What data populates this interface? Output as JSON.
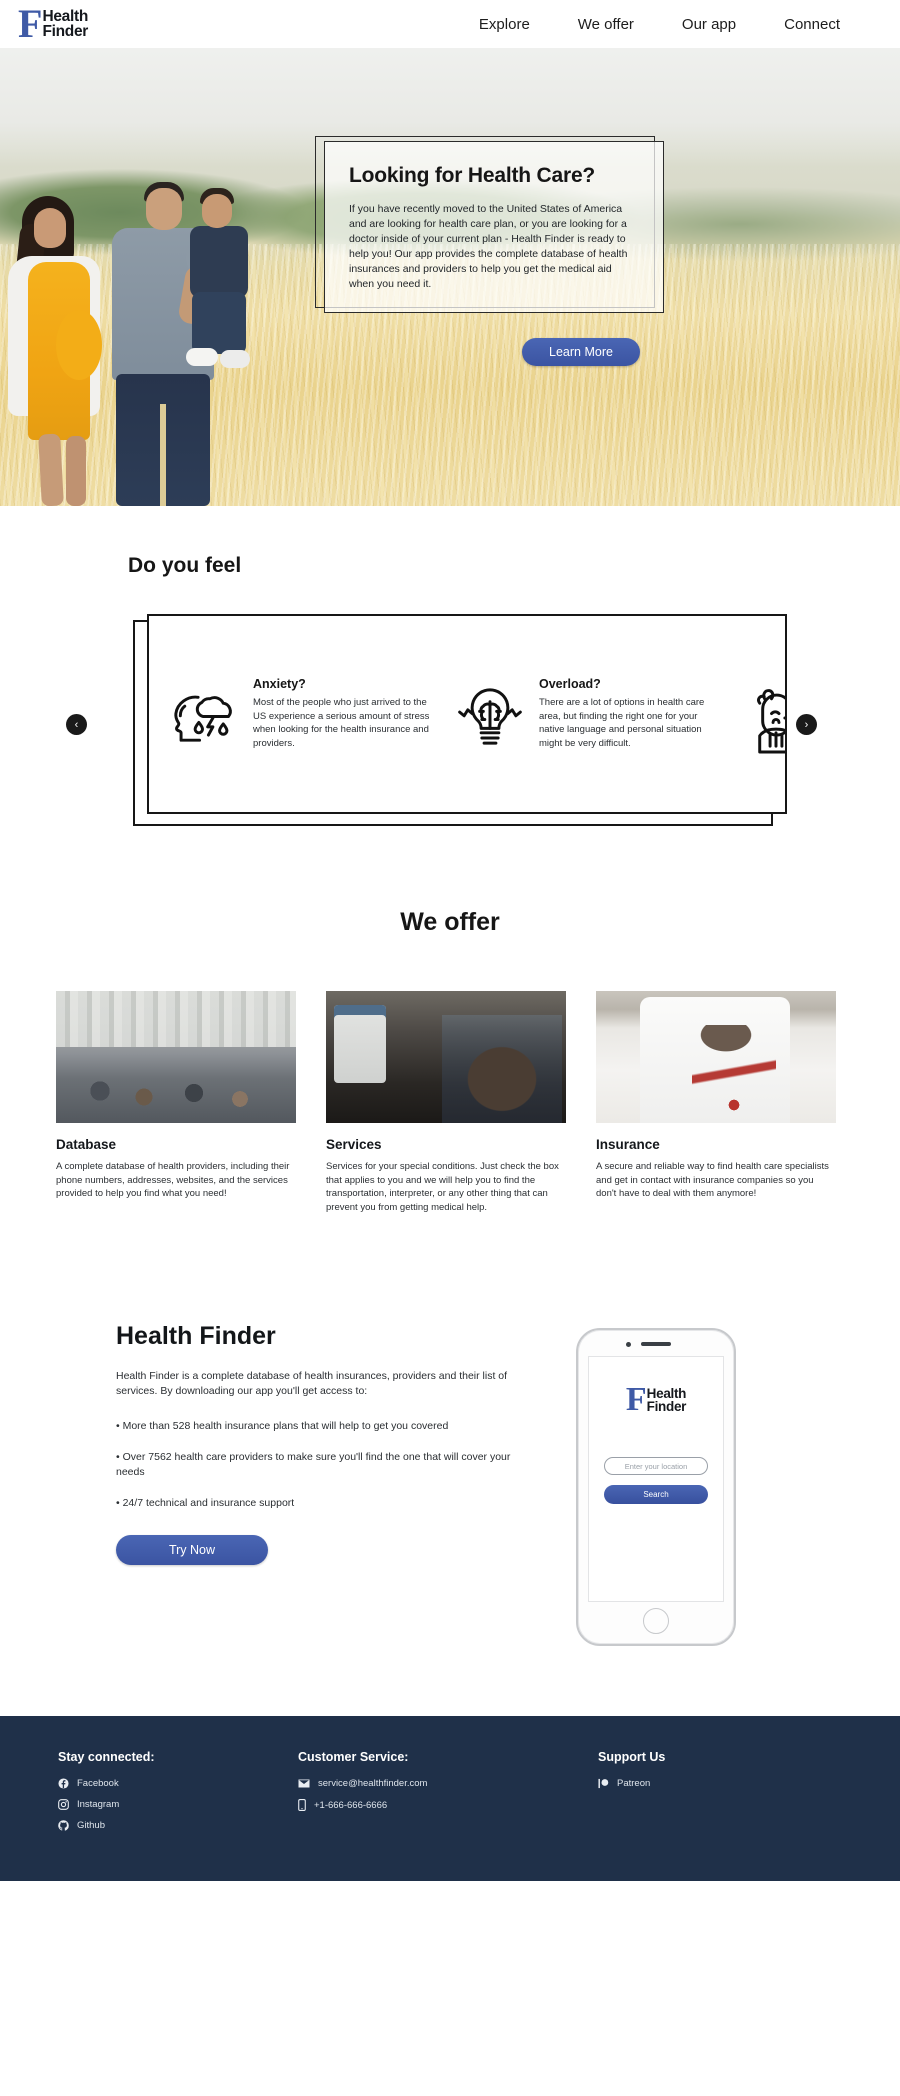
{
  "brand": {
    "mark": "F",
    "line1": "Health",
    "line2": "Finder"
  },
  "nav": {
    "items": [
      {
        "label": "Explore",
        "name": "nav-explore"
      },
      {
        "label": "We offer",
        "name": "nav-we-offer"
      },
      {
        "label": "Our app",
        "name": "nav-our-app"
      },
      {
        "label": "Connect",
        "name": "nav-connect"
      }
    ]
  },
  "hero": {
    "title": "Looking for Health Care?",
    "body": "If you have recently moved to the United States of America and are looking for health care plan, or you are looking for a doctor inside of your current plan - Health Finder is ready to help you! Our app provides the complete database of health insurances and providers to help you get the medical aid when you need it.",
    "cta": "Learn More",
    "cta_color": "#3e57a5"
  },
  "feel": {
    "title": "Do you feel",
    "prev_label": "‹",
    "next_label": "›",
    "cards": [
      {
        "icon": "head-storm-cloud-icon",
        "title": "Anxiety?",
        "text": "Most of the people who just arrived to the US experience a serious amount of stress when looking for the health insurance and providers."
      },
      {
        "icon": "lightbulb-brain-icon",
        "title": "Overload?",
        "text": "There are a lot of options in health care area, but finding the right one for your native language and personal situation might be very difficult."
      },
      {
        "icon": "confused-person-icon",
        "title": "",
        "text": ""
      }
    ]
  },
  "offer": {
    "title": "We offer",
    "cards": [
      {
        "image": "pharmacy-photo",
        "name": "Database",
        "text": "A complete database of health providers, including their phone numbers, addresses, websites, and the services provided to help you find what you need!"
      },
      {
        "image": "nurse-patient-photo",
        "name": "Services",
        "text": "Services for your special conditions. Just check the box that applies to you and we will help you to find the transportation, interpreter, or any other thing that can prevent you from getting medical help."
      },
      {
        "image": "doctor-stethoscope-photo",
        "name": "Insurance",
        "text": "A secure and reliable way to find health care specialists and get in contact with insurance companies so you don't have to deal with them anymore!"
      }
    ]
  },
  "app": {
    "title": "Health Finder",
    "intro": "Health Finder is a complete database of health insurances, providers and their list of services. By downloading our app you'll get access to:",
    "bullets": [
      "• More than 528 health insurance plans that will help to get you covered",
      "• Over 7562 health care providers to make sure you'll find the one that will cover your needs",
      "• 24/7 technical and insurance support"
    ],
    "cta": "Try Now",
    "phone": {
      "location_placeholder": "Enter your location",
      "location_value": "",
      "search_label": "Search"
    }
  },
  "footer": {
    "bg_color": "#1f3049",
    "columns": [
      {
        "heading": "Stay connected:",
        "items": [
          {
            "icon": "facebook-icon",
            "label": "Facebook"
          },
          {
            "icon": "instagram-icon",
            "label": "Instagram"
          },
          {
            "icon": "github-icon",
            "label": "Github"
          }
        ]
      },
      {
        "heading": "Customer Service:",
        "items": [
          {
            "icon": "envelope-icon",
            "label": "service@healthfinder.com"
          },
          {
            "icon": "phone-icon",
            "label": "+1-666-666-6666"
          }
        ]
      },
      {
        "heading": "Support Us",
        "items": [
          {
            "icon": "patreon-icon",
            "label": "Patreon"
          }
        ]
      }
    ]
  }
}
